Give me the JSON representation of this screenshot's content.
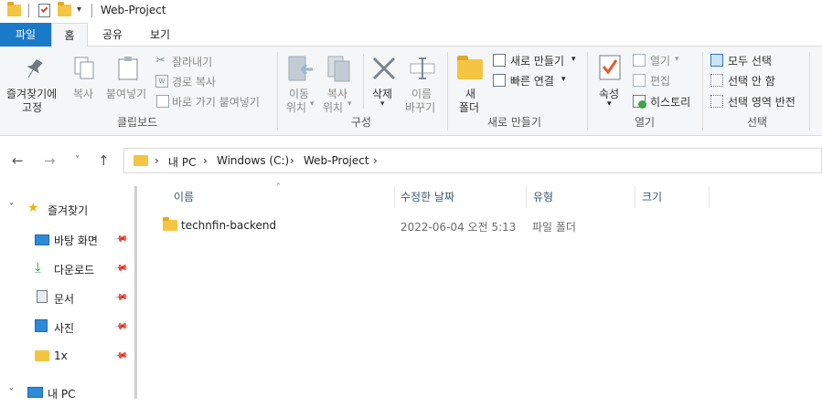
{
  "window": {
    "title": "Web-Project"
  },
  "tabs": {
    "file": "파일",
    "home": "홈",
    "share": "공유",
    "view": "보기"
  },
  "ribbon": {
    "clipboard": {
      "pin_label_1": "즐겨찾기에",
      "pin_label_2": "고정",
      "copy": "복사",
      "paste": "붙여넣기",
      "cut": "잘라내기",
      "copy_path": "경로 복사",
      "paste_shortcut": "바로 가기 붙여넣기",
      "group_label": "클립보드"
    },
    "organize": {
      "move_1": "이동",
      "move_2": "위치",
      "copyto_1": "복사",
      "copyto_2": "위치",
      "delete": "삭제",
      "rename_1": "이름",
      "rename_2": "바꾸기",
      "group_label": "구성"
    },
    "new": {
      "newfolder_1": "새",
      "newfolder_2": "폴더",
      "new_item": "새로 만들기",
      "easy_access": "빠른 연결",
      "group_label": "새로 만들기"
    },
    "open": {
      "properties": "속성",
      "open": "열기",
      "edit": "편집",
      "history": "히스토리",
      "group_label": "열기"
    },
    "select": {
      "select_all": "모두 선택",
      "select_none": "선택 안 함",
      "invert": "선택 영역 반전",
      "group_label": "선택"
    }
  },
  "address": {
    "crumbs": [
      "내 PC",
      "Windows (C:)",
      "Web-Project"
    ]
  },
  "navpane": {
    "favorites": "즐겨찾기",
    "items": [
      "바탕 화면",
      "다운로드",
      "문서",
      "사진",
      "1x"
    ],
    "this_pc": "내 PC"
  },
  "columns": {
    "name": "이름",
    "modified": "수정한 날짜",
    "type": "유형",
    "size": "크기"
  },
  "files": [
    {
      "name": "technfin-backend",
      "modified": "2022-06-04 오전 5:13",
      "type": "파일 폴더",
      "size": ""
    }
  ],
  "colors": {
    "accent": "#1a7ac7",
    "folder": "#f4c542",
    "ribbon_bg": "#f5f6f7"
  }
}
